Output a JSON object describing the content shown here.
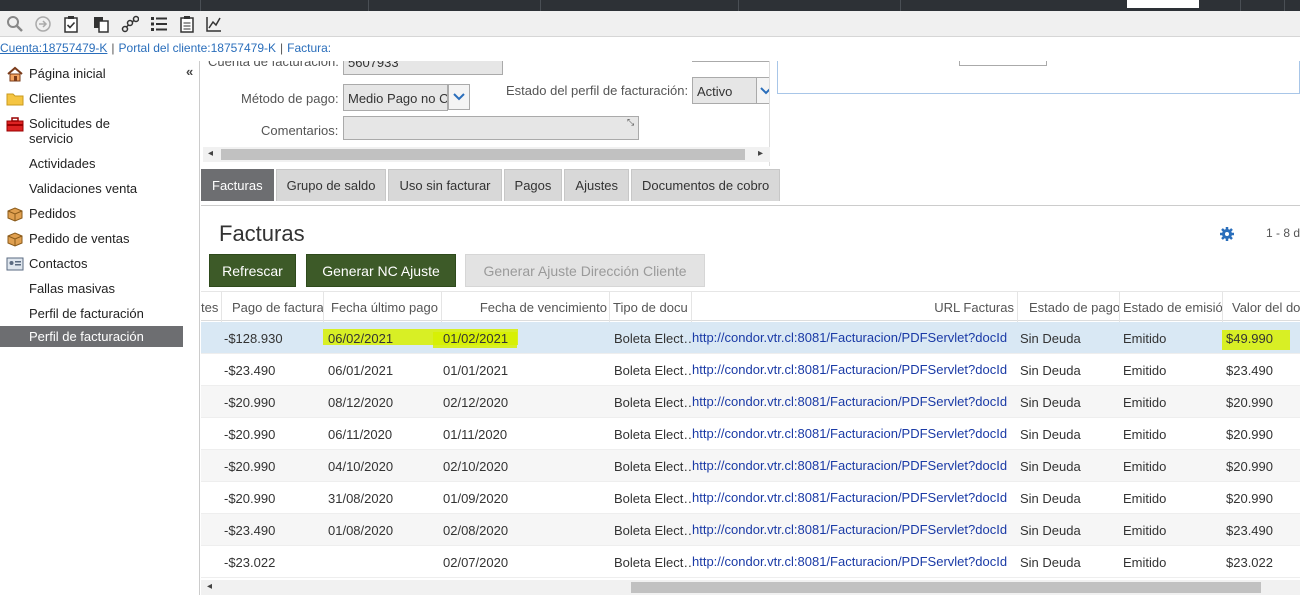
{
  "toolbar": {
    "icons": [
      "search-icon",
      "forward-circle-icon",
      "clipboard-check-icon",
      "copy-icon",
      "network-icon",
      "list-icon",
      "clipboard-icon",
      "chart-icon"
    ]
  },
  "breadcrumb": {
    "account": "Cuenta:18757479-K",
    "portal": "Portal del cliente:18757479-K",
    "invoice": "Factura:"
  },
  "sidebar": {
    "collapse": "«",
    "items": [
      {
        "label": "Página inicial",
        "icon": "home-icon"
      },
      {
        "label": "Clientes",
        "icon": "folder-icon"
      },
      {
        "label": "Solicitudes de servicio",
        "icon": "toolbox-icon"
      },
      {
        "label": "Actividades",
        "icon": ""
      },
      {
        "label": "Validaciones venta",
        "icon": ""
      },
      {
        "label": "Pedidos",
        "icon": "box-icon"
      },
      {
        "label": "Pedido de ventas",
        "icon": "box-icon"
      },
      {
        "label": "Contactos",
        "icon": "card-icon"
      },
      {
        "label": "Fallas masivas",
        "icon": ""
      },
      {
        "label": "Perfil de facturación",
        "icon": ""
      },
      {
        "label": "Perfil de facturación",
        "icon": "",
        "active": true
      }
    ]
  },
  "form": {
    "billing_account_label": "Cuenta de facturación:",
    "billing_account_value": "5607933",
    "payment_method_label": "Método de pago:",
    "payment_method_value": "Medio Pago no C",
    "profile_status_label": "Estado del perfil de facturación:",
    "profile_status_value": "Activo",
    "comments_label": "Comentarios:",
    "comments_value": ""
  },
  "tabs": [
    "Facturas",
    "Grupo de saldo",
    "Uso sin facturar",
    "Pagos",
    "Ajustes",
    "Documentos de cobro"
  ],
  "list": {
    "title": "Facturas",
    "pager": "1 - 8 d",
    "buttons": {
      "refresh": "Refrescar",
      "generate_nc": "Generar NC Ajuste",
      "generate_address": "Generar Ajuste Dirección Cliente"
    },
    "columns": [
      "tes",
      "Pago de factura",
      "Fecha último pago",
      "Fecha de vencimiento",
      "Tipo de docu",
      "URL Facturas",
      "Estado de pago",
      "Estado de emisió",
      "Valor del do"
    ],
    "rows": [
      {
        "pago": "-$128.930",
        "ultimo": "06/02/2021",
        "venc": "01/02/2021",
        "tipo": "Boleta Elect…",
        "url": "http://condor.vtr.cl:8081/Facturacion/PDFServlet?docId",
        "estado_pago": "Sin Deuda",
        "emision": "Emitido",
        "valor": "$49.990"
      },
      {
        "pago": "-$23.490",
        "ultimo": "06/01/2021",
        "venc": "01/01/2021",
        "tipo": "Boleta Elect…",
        "url": "http://condor.vtr.cl:8081/Facturacion/PDFServlet?docId",
        "estado_pago": "Sin Deuda",
        "emision": "Emitido",
        "valor": "$23.490"
      },
      {
        "pago": "-$20.990",
        "ultimo": "08/12/2020",
        "venc": "02/12/2020",
        "tipo": "Boleta Elect…",
        "url": "http://condor.vtr.cl:8081/Facturacion/PDFServlet?docId",
        "estado_pago": "Sin Deuda",
        "emision": "Emitido",
        "valor": "$20.990"
      },
      {
        "pago": "-$20.990",
        "ultimo": "06/11/2020",
        "venc": "01/11/2020",
        "tipo": "Boleta Elect…",
        "url": "http://condor.vtr.cl:8081/Facturacion/PDFServlet?docId",
        "estado_pago": "Sin Deuda",
        "emision": "Emitido",
        "valor": "$20.990"
      },
      {
        "pago": "-$20.990",
        "ultimo": "04/10/2020",
        "venc": "02/10/2020",
        "tipo": "Boleta Elect…",
        "url": "http://condor.vtr.cl:8081/Facturacion/PDFServlet?docId",
        "estado_pago": "Sin Deuda",
        "emision": "Emitido",
        "valor": "$20.990"
      },
      {
        "pago": "-$20.990",
        "ultimo": "31/08/2020",
        "venc": "01/09/2020",
        "tipo": "Boleta Elect…",
        "url": "http://condor.vtr.cl:8081/Facturacion/PDFServlet?docId",
        "estado_pago": "Sin Deuda",
        "emision": "Emitido",
        "valor": "$20.990"
      },
      {
        "pago": "-$23.490",
        "ultimo": "01/08/2020",
        "venc": "02/08/2020",
        "tipo": "Boleta Elect…",
        "url": "http://condor.vtr.cl:8081/Facturacion/PDFServlet?docId",
        "estado_pago": "Sin Deuda",
        "emision": "Emitido",
        "valor": "$23.490"
      },
      {
        "pago": "-$23.022",
        "ultimo": "",
        "venc": "02/07/2020",
        "tipo": "Boleta Elect…",
        "url": "http://condor.vtr.cl:8081/Facturacion/PDFServlet?docId",
        "estado_pago": "Sin Deuda",
        "emision": "Emitido",
        "valor": "$23.022"
      }
    ]
  },
  "colors": {
    "highlight": "#d7f000",
    "selected_row": "#d9e8f4",
    "button_dark": "#3d5a28",
    "link": "#1a3aa6"
  }
}
